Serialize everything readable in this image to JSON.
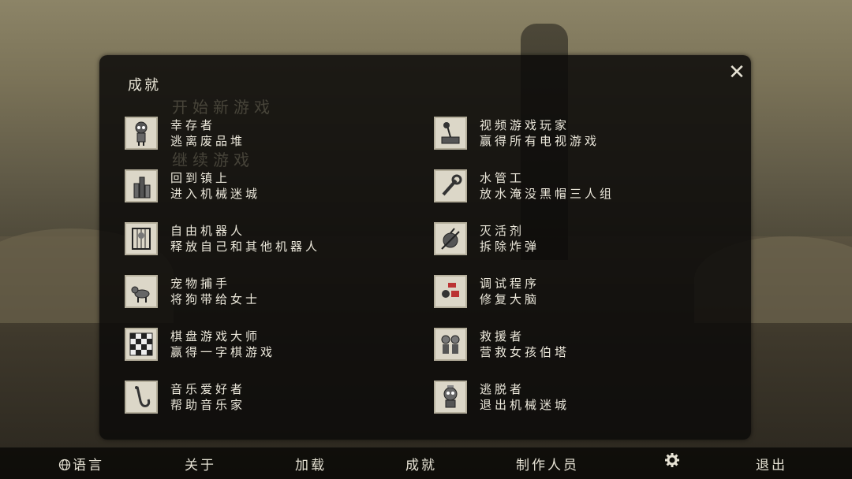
{
  "panel": {
    "title": "成就",
    "close_icon": "close-icon",
    "ghost_text": [
      "开始新游戏",
      "继续游戏"
    ]
  },
  "achievements": [
    {
      "name": "幸存者",
      "desc": "逃离废品堆",
      "icon": "robot-icon"
    },
    {
      "name": "视频游戏玩家",
      "desc": "赢得所有电视游戏",
      "icon": "joystick-icon"
    },
    {
      "name": "回到镇上",
      "desc": "进入机械迷城",
      "icon": "city-icon"
    },
    {
      "name": "水管工",
      "desc": "放水淹没黑帽三人组",
      "icon": "wrench-icon"
    },
    {
      "name": "自由机器人",
      "desc": "释放自己和其他机器人",
      "icon": "cage-icon"
    },
    {
      "name": "灭活剂",
      "desc": "拆除炸弹",
      "icon": "bomb-icon"
    },
    {
      "name": "宠物捕手",
      "desc": "将狗带给女士",
      "icon": "dog-icon"
    },
    {
      "name": "调试程序",
      "desc": "修复大脑",
      "icon": "debug-icon"
    },
    {
      "name": "棋盘游戏大师",
      "desc": "赢得一字棋游戏",
      "icon": "board-icon"
    },
    {
      "name": "救援者",
      "desc": "营救女孩伯塔",
      "icon": "rescue-icon"
    },
    {
      "name": "音乐爱好者",
      "desc": "帮助音乐家",
      "icon": "saxophone-icon"
    },
    {
      "name": "逃脱者",
      "desc": "退出机械迷城",
      "icon": "escape-robot-icon"
    }
  ],
  "menu": {
    "language": "语言",
    "about": "关于",
    "load": "加载",
    "achievements": "成就",
    "credits": "制作人员",
    "settings_icon": "gear-icon",
    "quit": "退出"
  }
}
